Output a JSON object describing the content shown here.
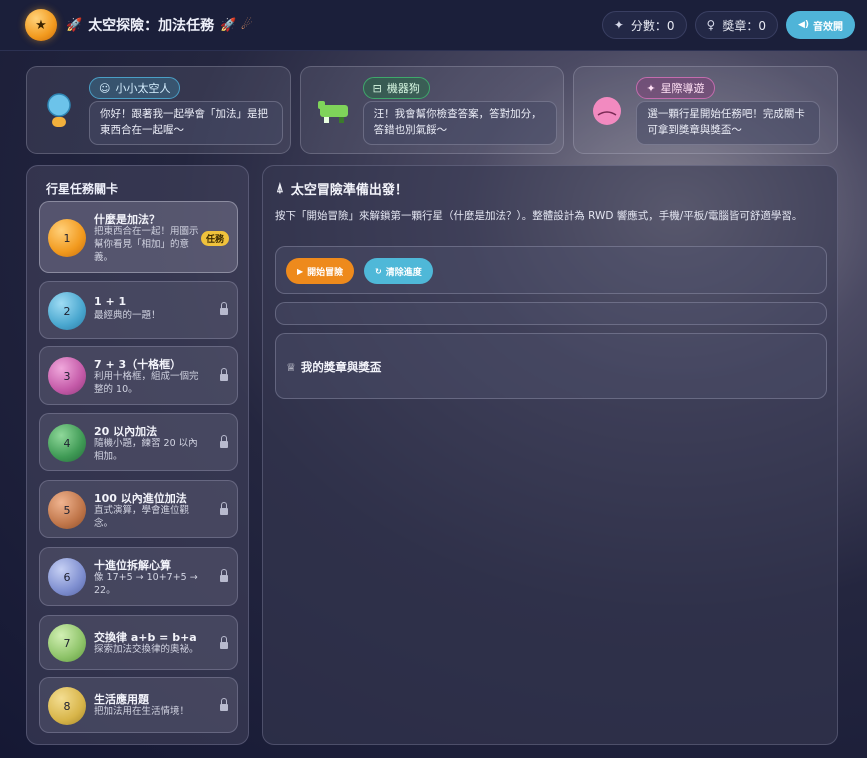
{
  "header": {
    "logo_icon": "★",
    "rocket_icon": "🚀",
    "title": "太空探險：加法任務",
    "title_deco": "🚀 ☄",
    "score_icon": "✦",
    "score_label": "分數：0",
    "medal_icon": "♀",
    "medal_label": "獎章：0",
    "sound_icon": "◀)",
    "sound_label": "音效開"
  },
  "characters": [
    {
      "tag": "小小太空人",
      "tag_icon": "☺",
      "message": "你好！跟著我一起學會「加法」是把東西合在一起喔～"
    },
    {
      "tag": "機器狗",
      "tag_icon": "⊟",
      "message": "汪！我會幫你檢查答案，答對加分，答錯也別氣餒～"
    },
    {
      "tag": "星際導遊",
      "tag_icon": "✦",
      "message": "選一顆行星開始任務吧！完成關卡可拿到獎章與獎盃～"
    }
  ],
  "sidebar": {
    "title": "行星任務關卡",
    "levels": [
      {
        "number": "1",
        "name": "什麼是加法？",
        "desc": "把東西合在一起！用圖示幫你看見「相加」的意義。",
        "status": "任務"
      },
      {
        "number": "2",
        "name": "1 + 1",
        "desc": "最經典的一題！",
        "status": "locked"
      },
      {
        "number": "3",
        "name": "7 + 3（十格框）",
        "desc": "利用十格框，組成一個完整的 10。",
        "status": "locked"
      },
      {
        "number": "4",
        "name": "20 以內加法",
        "desc": "隨機小題，練習 20 以內相加。",
        "status": "locked"
      },
      {
        "number": "5",
        "name": "100 以內進位加法",
        "desc": "直式演算，學會進位觀念。",
        "status": "locked"
      },
      {
        "number": "6",
        "name": "十進位拆解心算",
        "desc": "像 17+5 → 10+7+5 → 22。",
        "status": "locked"
      },
      {
        "number": "7",
        "name": "交換律 a+b = b+a",
        "desc": "探索加法交換律的奧祕。",
        "status": "locked"
      },
      {
        "number": "8",
        "name": "生活應用題",
        "desc": "把加法用在生活情境！",
        "status": "locked"
      }
    ]
  },
  "main": {
    "title_icon": "⍋",
    "title": "太空冒險準備出發！",
    "intro": "按下「開始冒險」來解鎖第一顆行星（什麼是加法？）。整體設計為 RWD 響應式，手機/平板/電腦皆可舒適學習。",
    "start_icon": "▶",
    "start_label": "開始冒險",
    "clear_icon": "↻",
    "clear_label": "清除進度",
    "awards_icon": "♕",
    "awards_title": "我的獎章與獎盃"
  },
  "colors": {
    "accent_orange": "#ee8a1c",
    "accent_cyan": "#4fb8d8",
    "badge_yellow": "#f0c23c",
    "orbs": [
      "#f29a1e",
      "#4aa7cf",
      "#c45aa8",
      "#3f9a55",
      "#c0764a",
      "#7f8fd0",
      "#8fc46a",
      "#d8b54a"
    ]
  }
}
